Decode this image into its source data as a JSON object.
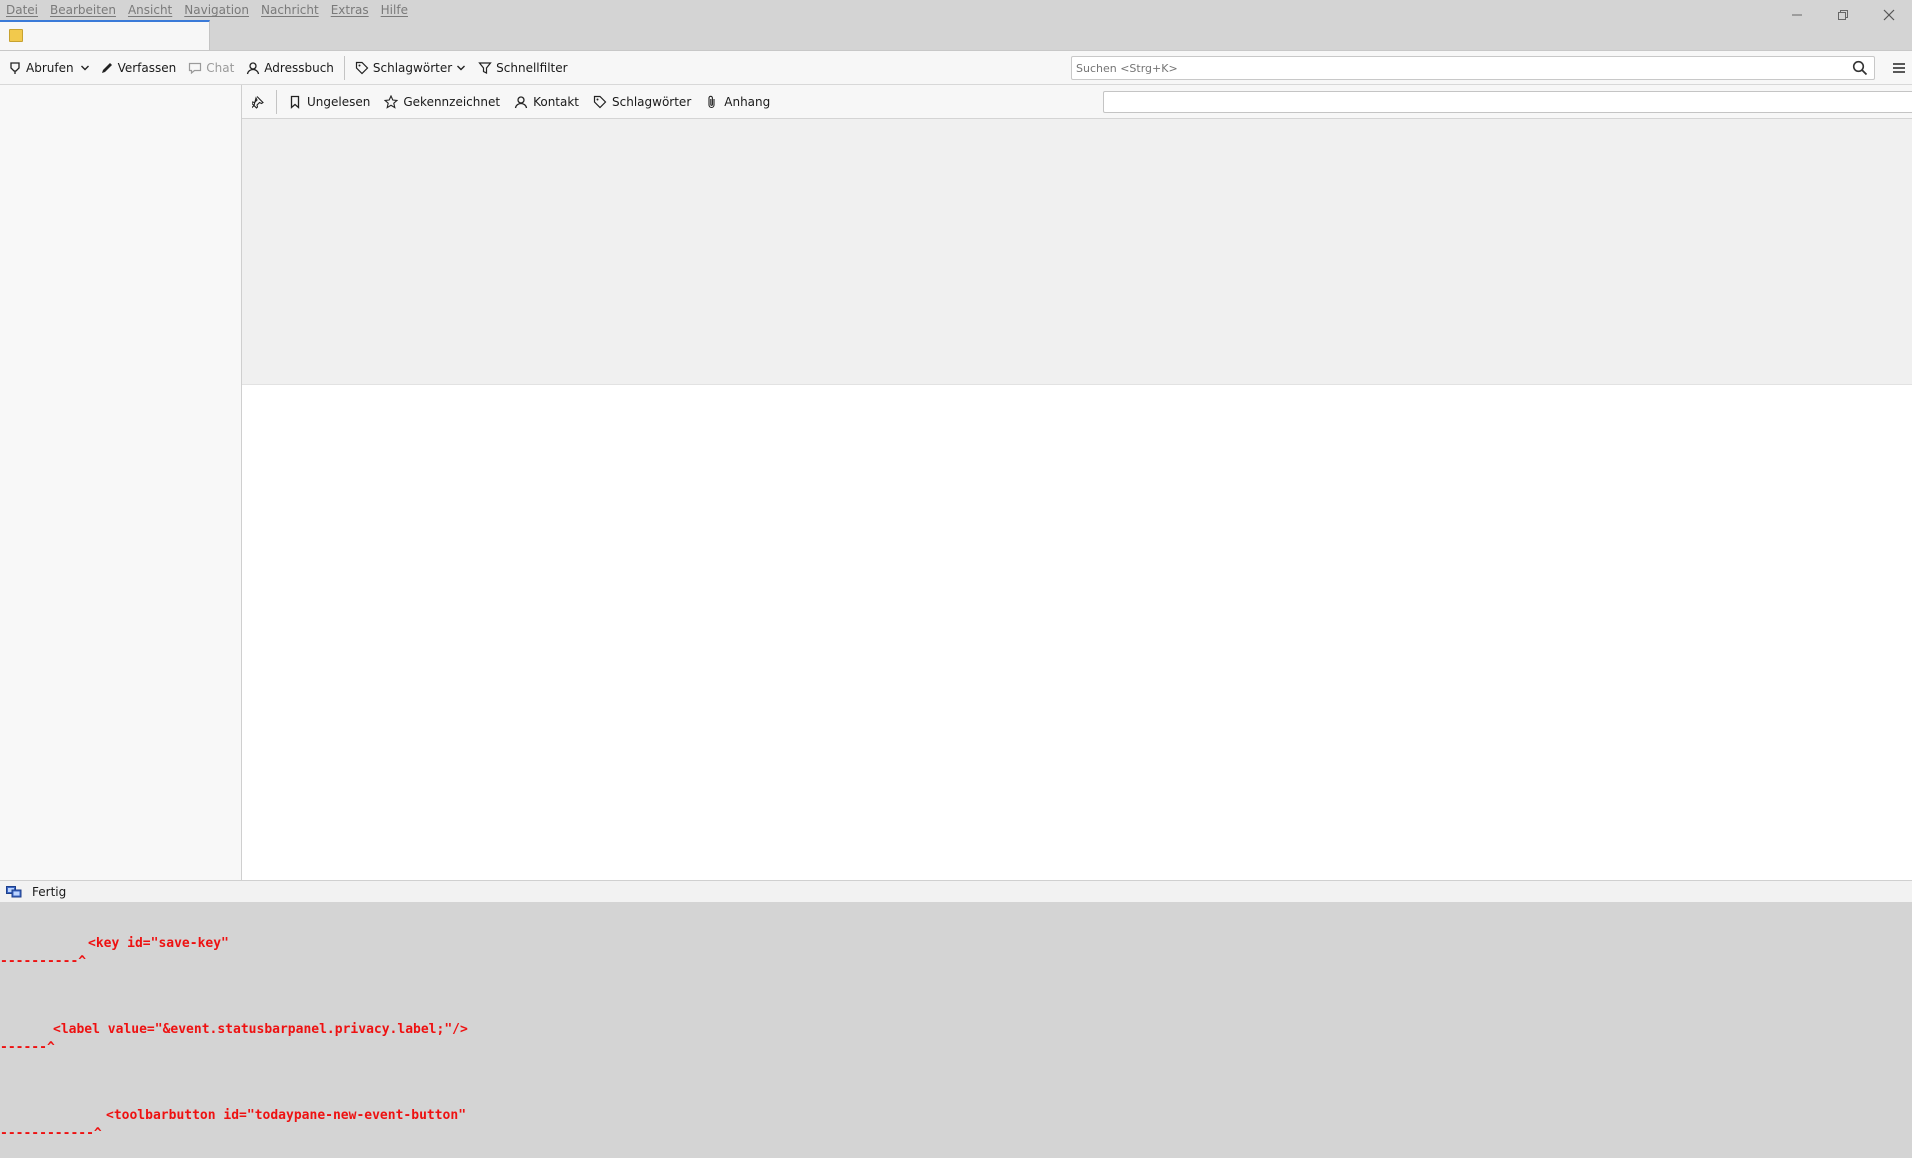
{
  "menubar": {
    "items": [
      "Datei",
      "Bearbeiten",
      "Ansicht",
      "Navigation",
      "Nachricht",
      "Extras",
      "Hilfe"
    ]
  },
  "window_controls": [
    "minimize-icon",
    "restore-icon",
    "close-icon"
  ],
  "toolbar": {
    "get_messages": "Abrufen",
    "compose": "Verfassen",
    "chat": "Chat",
    "address_book": "Adressbuch",
    "tags": "Schlagwörter",
    "quick_filter": "Schnellfilter"
  },
  "search": {
    "placeholder": "Suchen <Strg+K>"
  },
  "quickfilter": {
    "unread": "Ungelesen",
    "starred": "Gekennzeichnet",
    "contact": "Kontakt",
    "tags": "Schlagwörter",
    "attachment": "Anhang"
  },
  "statusbar": {
    "text": "Fertig"
  },
  "errors": {
    "line1": "<key id=\"save-key\"",
    "caret1": "----------^",
    "line2": "<label value=\"&event.statusbarpanel.privacy.label;\"/>",
    "caret2": "------^",
    "line3": "<toolbarbutton id=\"todaypane-new-event-button\"",
    "caret3": "------------^"
  },
  "colors": {
    "accent": "#3a7ad8",
    "error_text": "#ee1111",
    "chrome": "#d4d4d4"
  }
}
